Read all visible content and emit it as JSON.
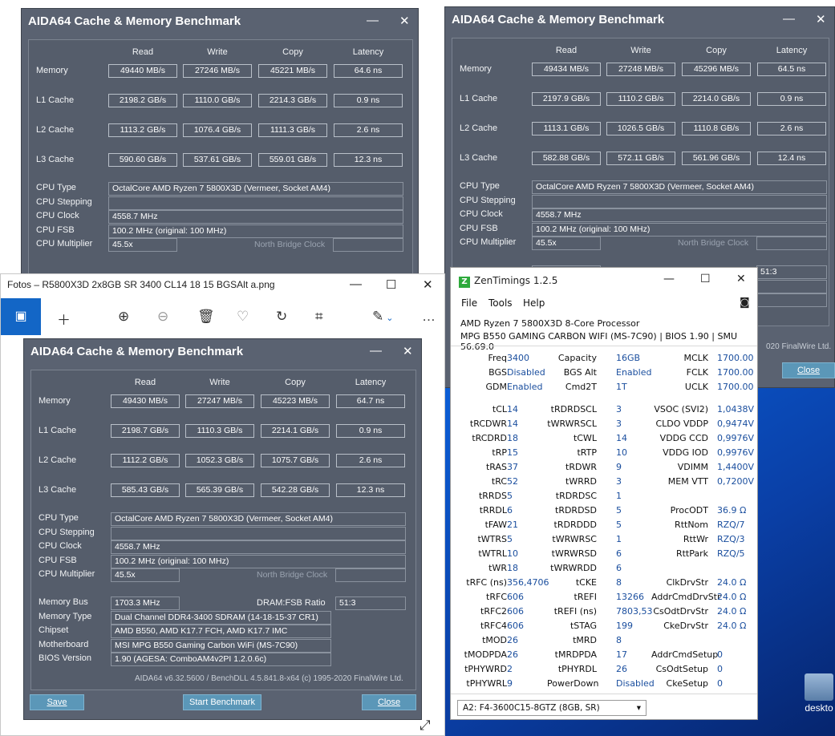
{
  "desktop": {
    "icons": [
      "desktop",
      "deskto"
    ]
  },
  "aida_title": "AIDA64 Cache & Memory Benchmark",
  "col_headers": [
    "Read",
    "Write",
    "Copy",
    "Latency"
  ],
  "row_labels": [
    "Memory",
    "L1 Cache",
    "L2 Cache",
    "L3 Cache"
  ],
  "cpu_labels": [
    "CPU Type",
    "CPU Stepping",
    "CPU Clock",
    "CPU FSB",
    "CPU Multiplier"
  ],
  "north_bridge": "North Bridge Clock",
  "windows": {
    "a": {
      "rows": [
        [
          "49440 MB/s",
          "27246 MB/s",
          "45221 MB/s",
          "64.6 ns"
        ],
        [
          "2198.2 GB/s",
          "1110.0 GB/s",
          "2214.3 GB/s",
          "0.9 ns"
        ],
        [
          "1113.2 GB/s",
          "1076.4 GB/s",
          "1111.3 GB/s",
          "2.6 ns"
        ],
        [
          "590.60 GB/s",
          "537.61 GB/s",
          "559.01 GB/s",
          "12.3 ns"
        ]
      ],
      "cpu": [
        "OctalCore AMD Ryzen 7 5800X3D  (Vermeer, Socket AM4)",
        "",
        "4558.7 MHz",
        "100.2 MHz  (original: 100 MHz)",
        "45.5x"
      ]
    },
    "b": {
      "rows": [
        [
          "49434 MB/s",
          "27248 MB/s",
          "45296 MB/s",
          "64.5 ns"
        ],
        [
          "2197.9 GB/s",
          "1110.2 GB/s",
          "2214.0 GB/s",
          "0.9 ns"
        ],
        [
          "1113.1 GB/s",
          "1026.5 GB/s",
          "1110.8 GB/s",
          "2.6 ns"
        ],
        [
          "582.88 GB/s",
          "572.11 GB/s",
          "561.96 GB/s",
          "12.4 ns"
        ]
      ],
      "cpu": [
        "OctalCore AMD Ryzen 7 5800X3D  (Vermeer, Socket AM4)",
        "",
        "4558.7 MHz",
        "100.2 MHz  (original: 100 MHz)",
        "45.5x"
      ],
      "ratio": "51:3",
      "copyright_tail": "020 FinalWire Ltd.",
      "close": "Close"
    },
    "c": {
      "rows": [
        [
          "49430 MB/s",
          "27247 MB/s",
          "45223 MB/s",
          "64.7 ns"
        ],
        [
          "2198.7 GB/s",
          "1110.3 GB/s",
          "2214.1 GB/s",
          "0.9 ns"
        ],
        [
          "1112.2 GB/s",
          "1052.3 GB/s",
          "1075.7 GB/s",
          "2.6 ns"
        ],
        [
          "585.43 GB/s",
          "565.39 GB/s",
          "542.28 GB/s",
          "12.3 ns"
        ]
      ],
      "cpu": [
        "OctalCore AMD Ryzen 7 5800X3D  (Vermeer, Socket AM4)",
        "",
        "4558.7 MHz",
        "100.2 MHz  (original: 100 MHz)",
        "45.5x"
      ],
      "mem_labels": [
        "Memory Bus",
        "Memory Type",
        "Chipset",
        "Motherboard",
        "BIOS Version"
      ],
      "mem_bus": "1703.3 MHz",
      "dram_ratio_label": "DRAM:FSB Ratio",
      "dram_ratio": "51:3",
      "mem_type": "Dual Channel DDR4-3400 SDRAM  (14-18-15-37 CR1)",
      "chipset": "AMD B550, AMD K17.7 FCH, AMD K17.7 IMC",
      "motherboard": "MSI MPG B550 Gaming Carbon WiFi (MS-7C90)",
      "bios": "1.90  (AGESA: ComboAM4v2PI 1.2.0.6c)",
      "footer": "AIDA64 v6.32.5600 / BenchDLL 4.5.841.8-x64  (c) 1995-2020 FinalWire Ltd.",
      "save": "Save",
      "start": "Start Benchmark",
      "close": "Close"
    }
  },
  "photos": {
    "title": "Fotos – R5800X3D 2x8GB SR 3400 CL14 18 15 BGSAlt a.png"
  },
  "zen": {
    "title": "ZenTimings 1.2.5",
    "menu": [
      "File",
      "Tools",
      "Help"
    ],
    "cpu": "AMD Ryzen 7 5800X3D 8-Core Processor",
    "board": "MPG B550 GAMING CARBON WIFI (MS-7C90) | BIOS 1.90 | SMU 56.69.0",
    "top": [
      [
        "Freq",
        "3400",
        "Capacity",
        "16GB",
        "MCLK",
        "1700.00"
      ],
      [
        "BGS",
        "Disabled",
        "BGS Alt",
        "Enabled",
        "FCLK",
        "1700.00"
      ],
      [
        "GDM",
        "Enabled",
        "Cmd2T",
        "1T",
        "UCLK",
        "1700.00"
      ]
    ],
    "rows": [
      [
        "tCL",
        "14",
        "tRDRDSCL",
        "3",
        "VSOC (SVI2)",
        "1,0438V"
      ],
      [
        "tRCDWR",
        "14",
        "tWRWRSCL",
        "3",
        "CLDO VDDP",
        "0,9474V"
      ],
      [
        "tRCDRD",
        "18",
        "tCWL",
        "14",
        "VDDG CCD",
        "0,9976V"
      ],
      [
        "tRP",
        "15",
        "tRTP",
        "10",
        "VDDG IOD",
        "0,9976V"
      ],
      [
        "tRAS",
        "37",
        "tRDWR",
        "9",
        "VDIMM",
        "1,4400V"
      ],
      [
        "tRC",
        "52",
        "tWRRD",
        "3",
        "MEM VTT",
        "0,7200V"
      ],
      [
        "tRRDS",
        "5",
        "tRDRDSC",
        "1",
        "",
        ""
      ],
      [
        "tRRDL",
        "6",
        "tRDRDSD",
        "5",
        "ProcODT",
        "36.9 Ω"
      ],
      [
        "tFAW",
        "21",
        "tRDRDDD",
        "5",
        "RttNom",
        "RZQ/7"
      ],
      [
        "tWTRS",
        "5",
        "tWRWRSC",
        "1",
        "RttWr",
        "RZQ/3"
      ],
      [
        "tWTRL",
        "10",
        "tWRWRSD",
        "6",
        "RttPark",
        "RZQ/5"
      ],
      [
        "tWR",
        "18",
        "tWRWRDD",
        "6",
        "",
        ""
      ],
      [
        "tRFC (ns)",
        "356,4706",
        "tCKE",
        "8",
        "ClkDrvStr",
        "24.0 Ω"
      ],
      [
        "tRFC",
        "606",
        "tREFI",
        "13266",
        "AddrCmdDrvStr",
        "24.0 Ω"
      ],
      [
        "tRFC2",
        "606",
        "tREFI (ns)",
        "7803,53",
        "CsOdtDrvStr",
        "24.0 Ω"
      ],
      [
        "tRFC4",
        "606",
        "tSTAG",
        "199",
        "CkeDrvStr",
        "24.0 Ω"
      ],
      [
        "tMOD",
        "26",
        "tMRD",
        "8",
        "",
        ""
      ],
      [
        "tMODPDA",
        "26",
        "tMRDPDA",
        "17",
        "AddrCmdSetup",
        "0"
      ],
      [
        "tPHYWRD",
        "2",
        "tPHYRDL",
        "26",
        "CsOdtSetup",
        "0"
      ],
      [
        "tPHYWRL",
        "9",
        "PowerDown",
        "Disabled",
        "CkeSetup",
        "0"
      ]
    ],
    "dimm": "A2: F4-3600C15-8GTZ (8GB, SR)"
  }
}
